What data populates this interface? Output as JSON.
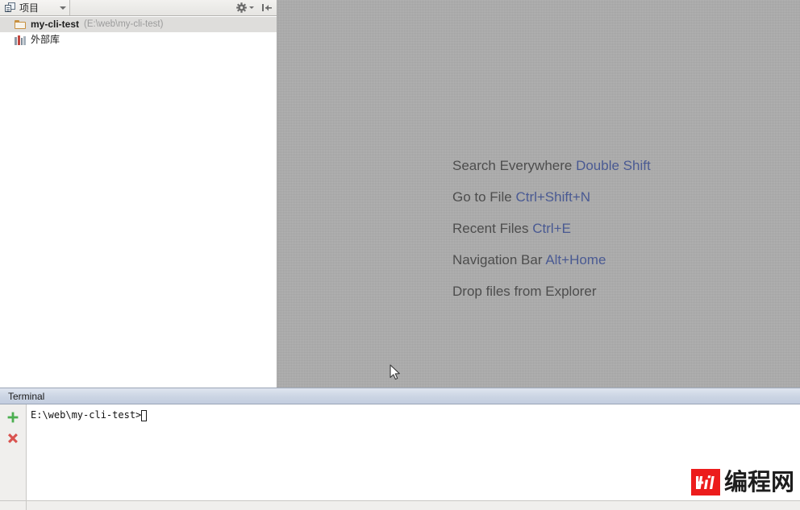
{
  "sidebar": {
    "toolbar": {
      "tab_label": "项目",
      "tab_icon": "project-view-icon",
      "dropdown_icon": "chevron-down-icon",
      "settings_icon": "gear-icon",
      "settings_dropdown_icon": "chevron-down-icon",
      "collapse_icon": "collapse-all-icon"
    },
    "tree": [
      {
        "icon": "folder-icon",
        "name": "my-cli-test",
        "path": "(E:\\web\\my-cli-test)",
        "selected": true
      },
      {
        "icon": "external-libraries-icon",
        "name": "外部库",
        "path": "",
        "selected": false
      }
    ]
  },
  "editor": {
    "hints": [
      {
        "label": "Search Everywhere",
        "shortcut": "Double Shift"
      },
      {
        "label": "Go to File",
        "shortcut": "Ctrl+Shift+N"
      },
      {
        "label": "Recent Files",
        "shortcut": "Ctrl+E"
      },
      {
        "label": "Navigation Bar",
        "shortcut": "Alt+Home"
      },
      {
        "label": "Drop files from Explorer",
        "shortcut": ""
      }
    ],
    "background_color": "#ababab",
    "hint_text_color": "#4d4d4d",
    "hint_key_color": "#4a5a93",
    "cursor_icon": "mouse-pointer-icon"
  },
  "terminal": {
    "tab_label": "Terminal",
    "add_icon": "plus-icon",
    "close_icon": "close-x-icon",
    "add_icon_color": "#4caf50",
    "close_icon_color": "#d9534f",
    "prompt": "E:\\web\\my-cli-test>",
    "caret_visible": true
  },
  "watermark": {
    "logo_text": "Hj",
    "text": "编程网",
    "logo_color": "#ec1c1c"
  }
}
